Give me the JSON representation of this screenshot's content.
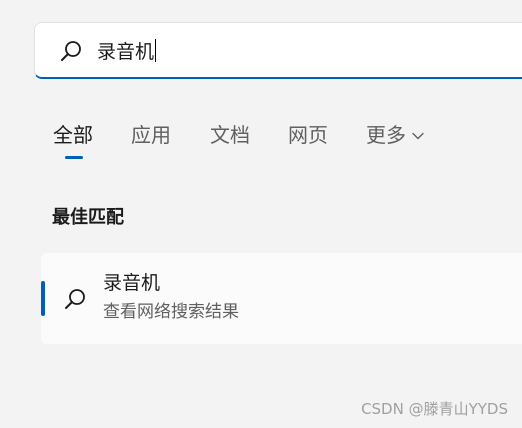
{
  "search": {
    "value": "录音机",
    "icon": "search-icon",
    "accent_color": "#005fb8"
  },
  "tabs": [
    {
      "label": "全部",
      "active": true
    },
    {
      "label": "应用",
      "active": false
    },
    {
      "label": "文档",
      "active": false
    },
    {
      "label": "网页",
      "active": false
    },
    {
      "label": "更多",
      "active": false,
      "icon": "chevron-down-icon"
    }
  ],
  "best_match": {
    "heading": "最佳匹配",
    "result": {
      "title": "录音机",
      "subtitle": "查看网络搜索结果",
      "icon": "search-icon"
    }
  },
  "watermark": "CSDN @滕青山YYDS"
}
